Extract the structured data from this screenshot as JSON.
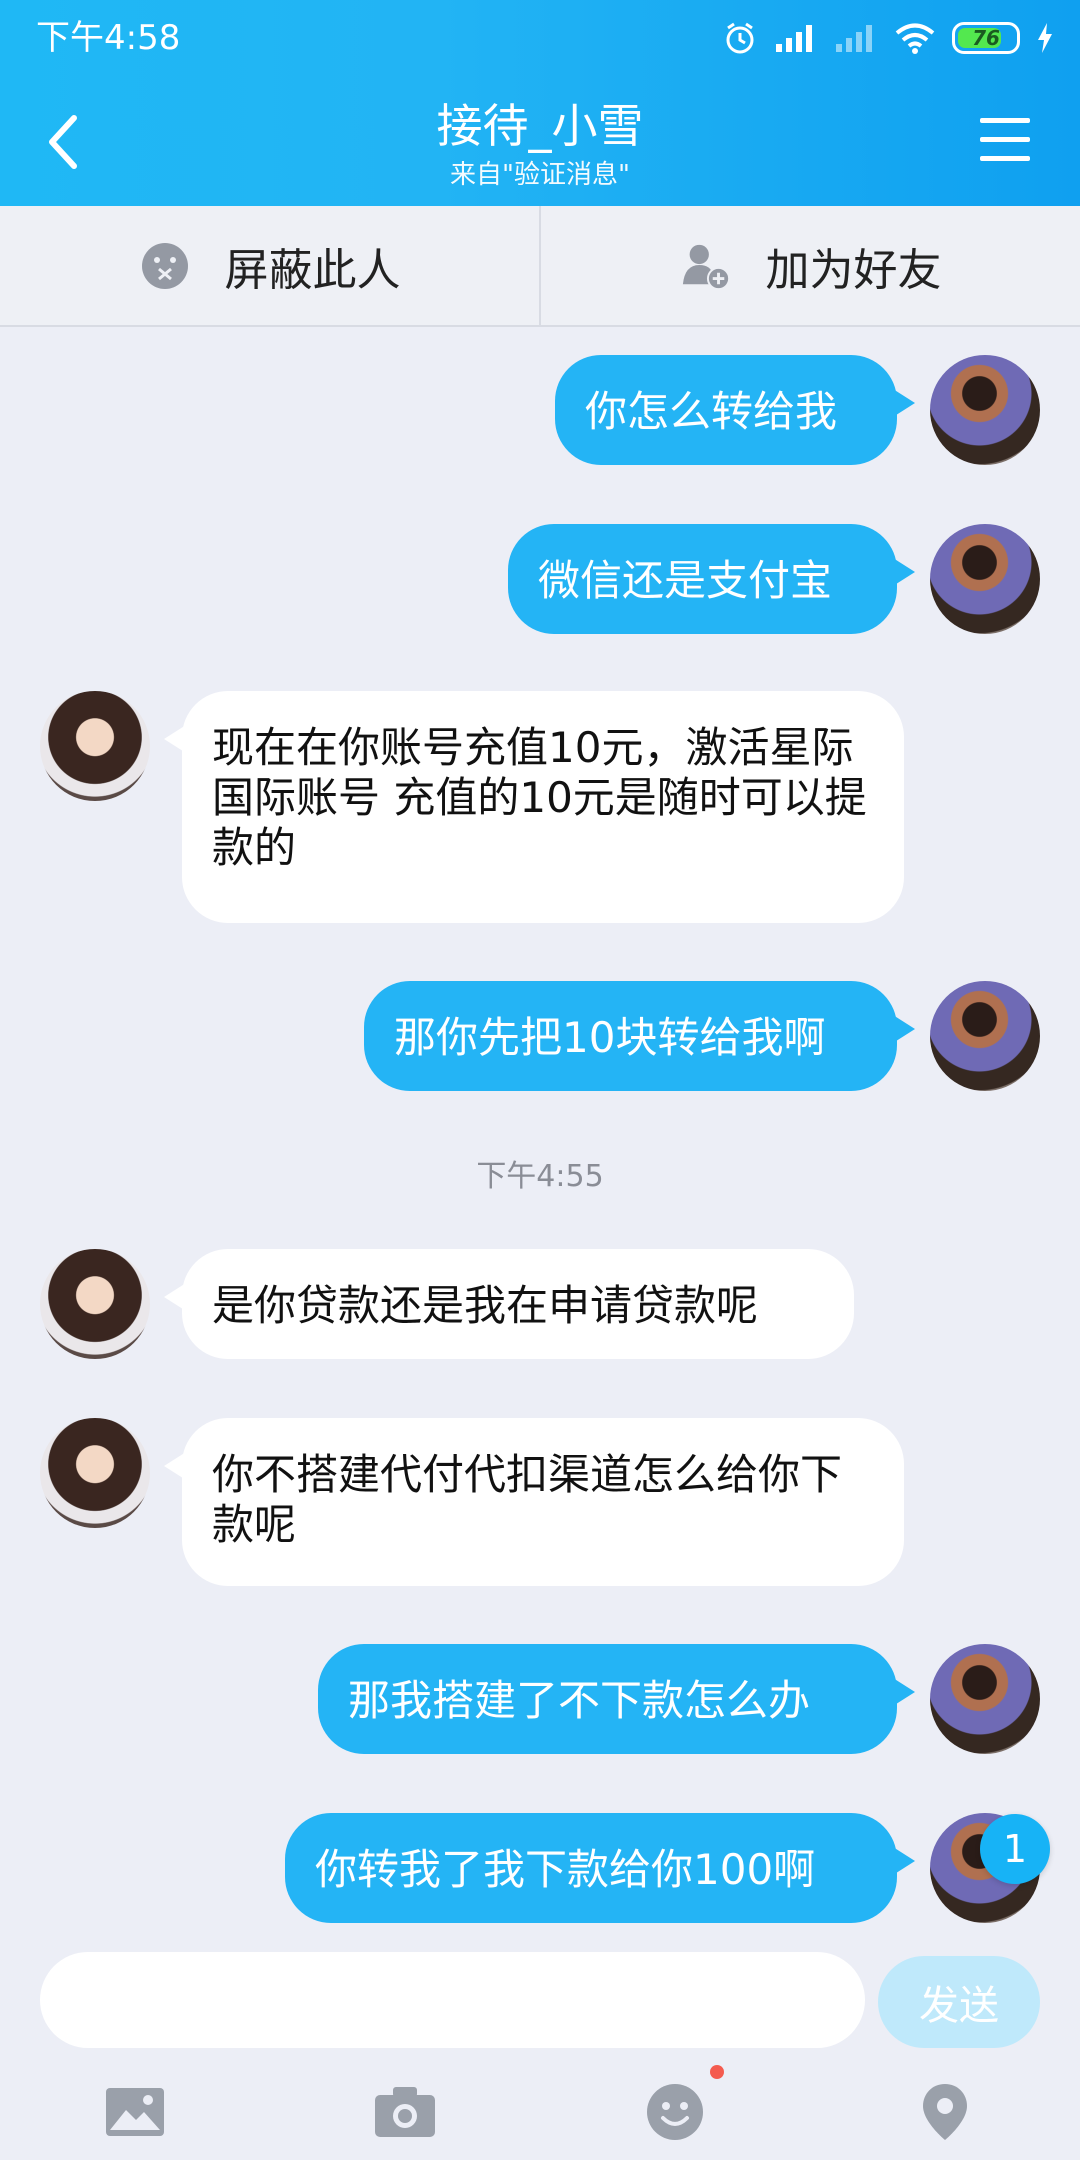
{
  "status": {
    "time": "下午4:58",
    "battery": "76"
  },
  "header": {
    "title": "接待_小雪",
    "subtitle": "来自\"验证消息\""
  },
  "actions": {
    "block": "屏蔽此人",
    "add_friend": "加为好友"
  },
  "messages": [
    {
      "from": "me",
      "text": "你怎么转给我"
    },
    {
      "from": "me",
      "text": "微信还是支付宝"
    },
    {
      "from": "her",
      "text": "现在在你账号充值10元，激活星际国际账号 充值的10元是随时可以提款的"
    },
    {
      "from": "me",
      "text": "那你先把10块转给我啊"
    },
    {
      "from": "her",
      "text": "是你贷款还是我在申请贷款呢"
    },
    {
      "from": "her",
      "text": "你不搭建代付代扣渠道怎么给你下款呢"
    },
    {
      "from": "me",
      "text": "那我搭建了不下款怎么办"
    },
    {
      "from": "me",
      "text": "你转我了我下款给你100啊"
    }
  ],
  "timestamp": "下午4:55",
  "unread_count": "1",
  "input": {
    "placeholder": "",
    "send_label": "发送"
  },
  "toolbar": [
    "image-icon",
    "camera-icon",
    "emoji-icon",
    "location-icon"
  ],
  "colors": {
    "accent": "#24b4f5",
    "header": "#1fb8f5",
    "background": "#eceef6"
  }
}
